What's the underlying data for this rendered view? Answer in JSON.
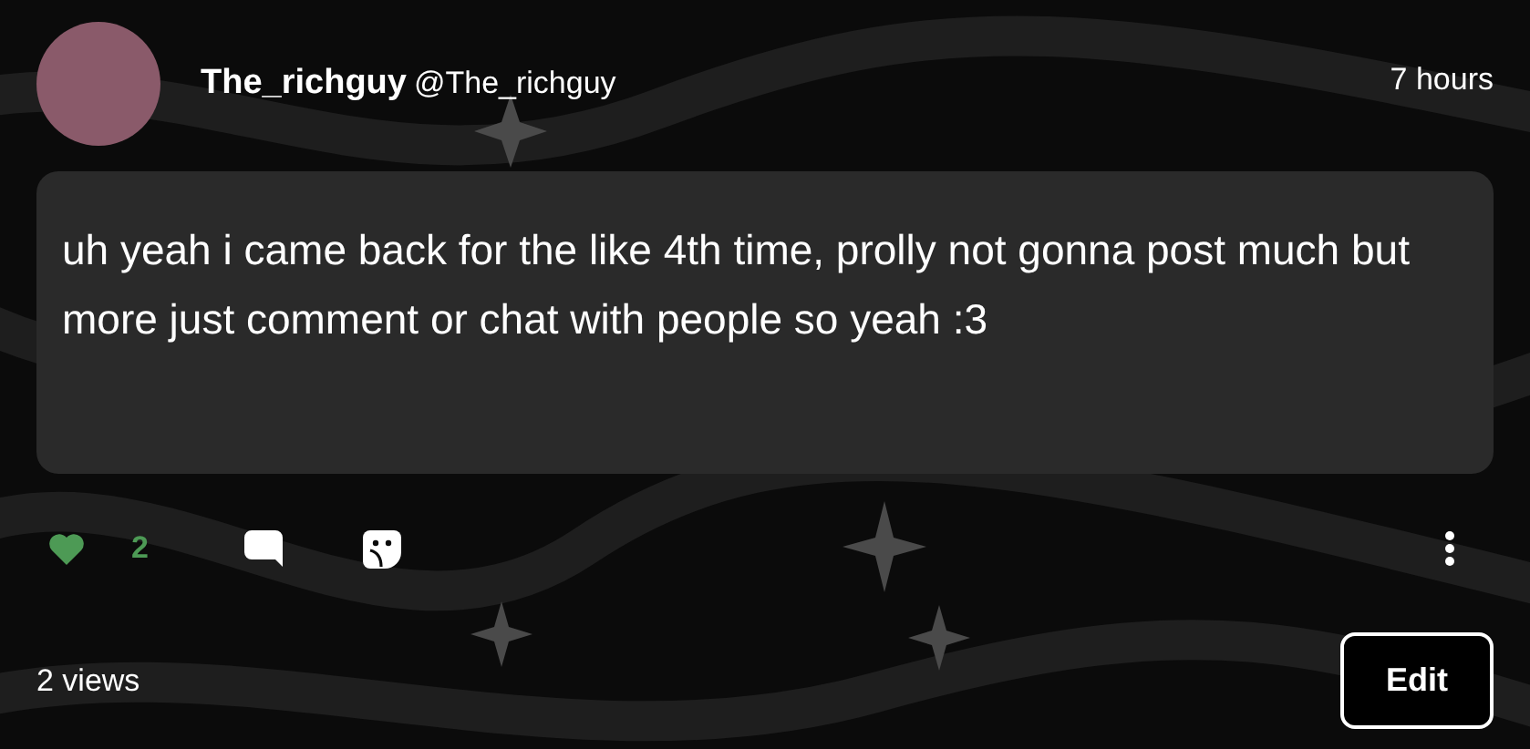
{
  "post": {
    "author_name": "The_richguy",
    "handle": "@The_richguy",
    "time": "7 hours",
    "body": "uh yeah i came back for the like 4th time, prolly not gonna post much but more just comment or chat with people so yeah :3",
    "liked": true,
    "like_count": "2",
    "views": "2 views",
    "edit_button": "Edit"
  }
}
